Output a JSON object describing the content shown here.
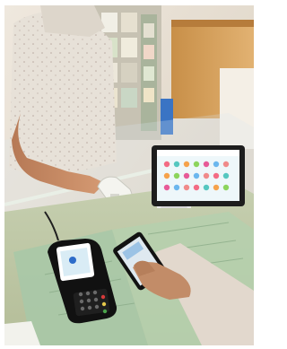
{
  "scene": {
    "frame_color": "#ffffff",
    "palette": {
      "counter": "#b9c4a1",
      "mat": "#a9c9a8",
      "shirt": "#e6e0d7",
      "shelf": "#d6a35d",
      "terminal": "#141414",
      "tablet_screen": "#e8f3f7"
    },
    "tablet_display": {
      "rows": 3,
      "dots_per_row": 7,
      "dot_colors": [
        "#f36b84",
        "#55c7c0",
        "#f6a24b",
        "#8cd45c",
        "#e75a98",
        "#6bb7ee",
        "#f08a8a"
      ]
    }
  }
}
